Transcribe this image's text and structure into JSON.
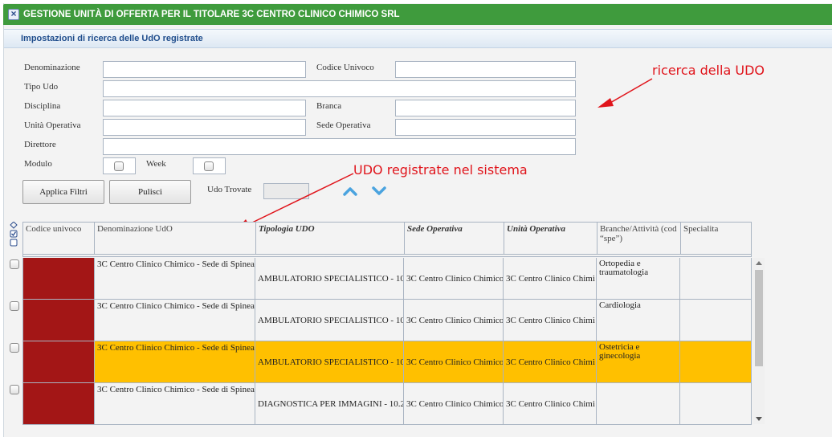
{
  "window": {
    "title": "GESTIONE UNITÀ DI OFFERTA PER IL TITOLARE 3C CENTRO CLINICO CHIMICO SRL",
    "section_title": "Impostazioni di ricerca delle UdO registrate"
  },
  "form": {
    "denominazione_label": "Denominazione",
    "codice_univoco_label": "Codice Univoco",
    "tipo_udo_label": "Tipo Udo",
    "disciplina_label": "Disciplina",
    "branca_label": "Branca",
    "unita_operativa_label": "Unità Operativa",
    "sede_operativa_label": "Sede Operativa",
    "direttore_label": "Direttore",
    "modulo_label": "Modulo",
    "week_label": "Week",
    "apply_button": "Applica Filtri",
    "clear_button": "Pulisci",
    "udo_trovate_label": "Udo Trovate",
    "udo_trovate_value": ""
  },
  "annotations": {
    "search": "ricerca della UDO",
    "registered": "UDO registrate nel sistema"
  },
  "table": {
    "columns": [
      "Codice univoco",
      "Denominazione UdO",
      "Tipologia UDO",
      "Sede Operativa",
      "Unità Operativa",
      "Branche/Attività (cod “spe”)",
      "Specialita"
    ],
    "rows": [
      {
        "codice": "",
        "denominazione": "3C Centro Clinico Chimico - Sede di Spinea",
        "tipologia": "AMBULATORIO SPECIALISTICO - 10",
        "sede": "3C Centro Clinico Chimico",
        "unita": "3C Centro Clinico Chimi",
        "branche": "Ortopedia e traumatologia",
        "specialita": "",
        "selected": false
      },
      {
        "codice": "",
        "denominazione": "3C Centro Clinico Chimico - Sede di Spinea",
        "tipologia": "AMBULATORIO SPECIALISTICO - 10",
        "sede": "3C Centro Clinico Chimico",
        "unita": "3C Centro Clinico Chimi",
        "branche": "Cardiologia",
        "specialita": "",
        "selected": false
      },
      {
        "codice": "",
        "denominazione": "3C Centro Clinico Chimico - Sede di Spinea",
        "tipologia": "AMBULATORIO SPECIALISTICO - 10",
        "sede": "3C Centro Clinico Chimico",
        "unita": "3C Centro Clinico Chimi",
        "branche": "Ostetricia e ginecologia",
        "specialita": "",
        "selected": true
      },
      {
        "codice": "",
        "denominazione": "3C Centro Clinico Chimico - Sede di Spinea",
        "tipologia": "DIAGNOSTICA PER IMMAGINI - 10.2",
        "sede": "3C Centro Clinico Chimico",
        "unita": "3C Centro Clinico Chimi",
        "branche": "",
        "specialita": "",
        "selected": false
      }
    ]
  },
  "colors": {
    "titlebar": "#3f9b3d",
    "codice_cell": "#a31616",
    "selected_row": "#ffc000",
    "annotation": "#e0141b",
    "nav_arrows": "#4aa3df"
  },
  "icons": {
    "close": "close-icon",
    "nav_up": "chevron-up-icon",
    "nav_down": "chevron-down-icon",
    "select_all": "select-all-icon"
  }
}
